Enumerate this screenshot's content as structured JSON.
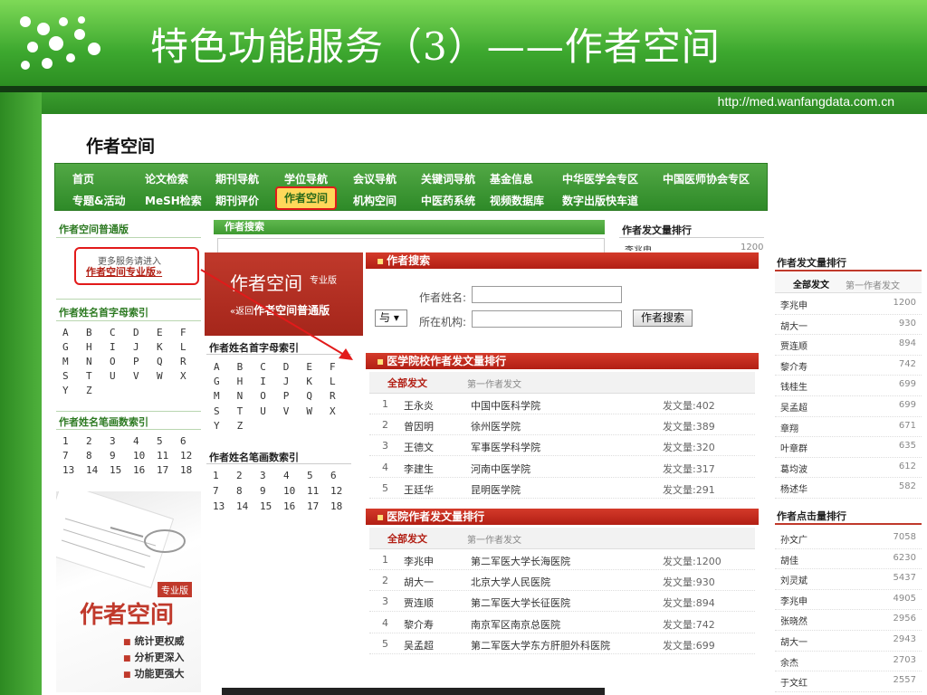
{
  "slide": {
    "title": "特色功能服务（3）——作者空间",
    "url": "http://med.wanfangdata.com.cn",
    "section_heading": "作者空间"
  },
  "nav": {
    "row1": [
      "首页",
      "论文检索",
      "期刊导航",
      "学位导航",
      "会议导航",
      "关键词导航",
      "基金信息",
      "中华医学会专区",
      "中国医师协会专区"
    ],
    "row2": [
      "专题&活动",
      "MeSH检索",
      "期刊评价",
      "作者空间",
      "机构空间",
      "中医药系统",
      "视频数据库",
      "数字出版快车道"
    ]
  },
  "left": {
    "normal_title": "作者空间普通版",
    "more_line": "更多服务请进入",
    "pro_link": "作者空间专业版»",
    "letter_title": "作者姓名首字母索引",
    "letters": [
      "A",
      "B",
      "C",
      "D",
      "E",
      "F",
      "G",
      "H",
      "I",
      "J",
      "K",
      "L",
      "M",
      "N",
      "O",
      "P",
      "Q",
      "R",
      "S",
      "T",
      "U",
      "V",
      "W",
      "X",
      "Y",
      "Z"
    ],
    "stroke_title": "作者姓名笔画数索引",
    "strokes": [
      "1",
      "2",
      "3",
      "4",
      "5",
      "6",
      "7",
      "8",
      "9",
      "10",
      "11",
      "12",
      "13",
      "14",
      "15",
      "16",
      "17",
      "18"
    ]
  },
  "middle_back": {
    "search_title": "作者搜索",
    "promo_main": "作者空间",
    "promo_tag": "专业版",
    "promo_return_prefix": "«返回",
    "promo_return": "作者空间普通版",
    "letter_title": "作者姓名首字母索引",
    "stroke_title": "作者姓名笔画数索引"
  },
  "right_back": {
    "title": "作者发文量排行",
    "first": "李兆申",
    "first_value": "1200"
  },
  "search": {
    "title": "作者搜索",
    "name_label": "作者姓名:",
    "org_label": "所在机构:",
    "logic": "与",
    "button": "作者搜索"
  },
  "school_rank": {
    "title": "医学院校作者发文量排行",
    "tab_all": "全部发文",
    "tab_first": "第一作者发文",
    "rows": [
      {
        "rank": "1",
        "name": "王永炎",
        "org": "中国中医科学院",
        "count": "发文量:402"
      },
      {
        "rank": "2",
        "name": "曾因明",
        "org": "徐州医学院",
        "count": "发文量:389"
      },
      {
        "rank": "3",
        "name": "王德文",
        "org": "军事医学科学院",
        "count": "发文量:320"
      },
      {
        "rank": "4",
        "name": "李建生",
        "org": "河南中医学院",
        "count": "发文量:317"
      },
      {
        "rank": "5",
        "name": "王廷华",
        "org": "昆明医学院",
        "count": "发文量:291"
      }
    ]
  },
  "hospital_rank": {
    "title": "医院作者发文量排行",
    "tab_all": "全部发文",
    "tab_first": "第一作者发文",
    "rows": [
      {
        "rank": "1",
        "name": "李兆申",
        "org": "第二军医大学长海医院",
        "count": "发文量:1200"
      },
      {
        "rank": "2",
        "name": "胡大一",
        "org": "北京大学人民医院",
        "count": "发文量:930"
      },
      {
        "rank": "3",
        "name": "贾连顺",
        "org": "第二军医大学长征医院",
        "count": "发文量:894"
      },
      {
        "rank": "4",
        "name": "黎介寿",
        "org": "南京军区南京总医院",
        "count": "发文量:742"
      },
      {
        "rank": "5",
        "name": "吴孟超",
        "org": "第二军医大学东方肝胆外科医院",
        "count": "发文量:699"
      }
    ]
  },
  "right_pub": {
    "title": "作者发文量排行",
    "tab_all": "全部发文",
    "tab_first": "第一作者发文",
    "rows": [
      {
        "name": "李兆申",
        "value": "1200"
      },
      {
        "name": "胡大一",
        "value": "930"
      },
      {
        "name": "贾连顺",
        "value": "894"
      },
      {
        "name": "黎介寿",
        "value": "742"
      },
      {
        "name": "钱桂生",
        "value": "699"
      },
      {
        "name": "吴孟超",
        "value": "699"
      },
      {
        "name": "章翔",
        "value": "671"
      },
      {
        "name": "叶章群",
        "value": "635"
      },
      {
        "name": "葛均波",
        "value": "612"
      },
      {
        "name": "杨述华",
        "value": "582"
      }
    ]
  },
  "right_click": {
    "title": "作者点击量排行",
    "rows": [
      {
        "name": "孙文广",
        "value": "7058"
      },
      {
        "name": "胡佳",
        "value": "6230"
      },
      {
        "name": "刘灵斌",
        "value": "5437"
      },
      {
        "name": "李兆申",
        "value": "4905"
      },
      {
        "name": "张晓然",
        "value": "2956"
      },
      {
        "name": "胡大一",
        "value": "2943"
      },
      {
        "name": "余杰",
        "value": "2703"
      },
      {
        "name": "于文红",
        "value": "2557"
      }
    ]
  },
  "ad": {
    "badge": "专业版",
    "brand": "作者空间",
    "features": [
      "统计更权威",
      "分析更深入",
      "功能更强大"
    ]
  },
  "colors": {
    "green": "#3da82f",
    "nav_green": "#2e8a28",
    "accent_red": "#b21f14",
    "highlight": "#ffd85a"
  }
}
